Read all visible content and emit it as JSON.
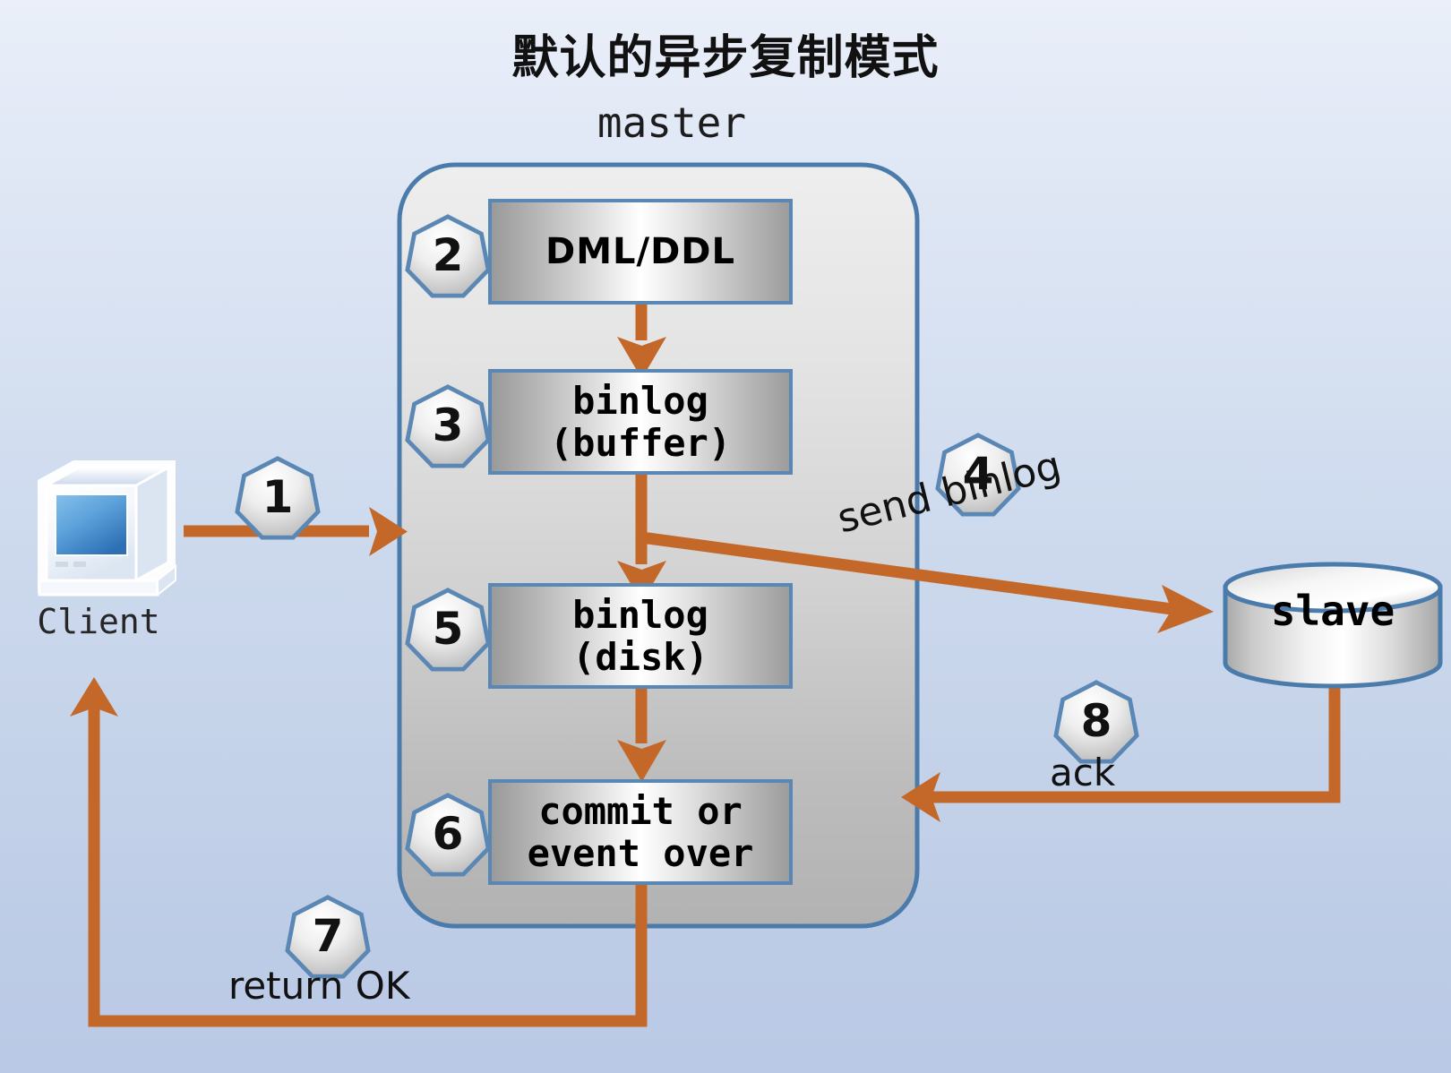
{
  "title": "默认的异步复制模式",
  "nodes": {
    "master_label": "master",
    "client_label": "Client",
    "client_icon": "desktop-computer-icon",
    "slave_label": "slave",
    "slave_icon": "database-cylinder-icon"
  },
  "steps": [
    {
      "number": "1",
      "label": ""
    },
    {
      "number": "2",
      "label": "DML/DDL"
    },
    {
      "number": "3",
      "label": "binlog\n(buffer)"
    },
    {
      "number": "4",
      "label": "send binlog"
    },
    {
      "number": "5",
      "label": "binlog\n(disk)"
    },
    {
      "number": "6",
      "label": "commit or\nevent over"
    },
    {
      "number": "7",
      "label": "return OK"
    },
    {
      "number": "8",
      "label": "ack"
    }
  ],
  "boxes": {
    "dml_ddl": "DML/DDL",
    "binlog_buffer_line1": "binlog",
    "binlog_buffer_line2": "(buffer)",
    "binlog_disk_line1": "binlog",
    "binlog_disk_line2": "(disk)",
    "commit_line1": "commit or",
    "commit_line2": "event over"
  },
  "badges": {
    "b1": "1",
    "b2": "2",
    "b3": "3",
    "b4": "4",
    "b5": "5",
    "b6": "6",
    "b7": "7",
    "b8": "8"
  },
  "edge_labels": {
    "send_binlog": "send binlog",
    "ack": "ack",
    "return_ok": "return OK"
  },
  "colors": {
    "arrow": "#c4682a",
    "node_border": "#5b87b5",
    "background_top": "#eaeff9",
    "background_bottom": "#bac9e5",
    "text": "#111111"
  }
}
